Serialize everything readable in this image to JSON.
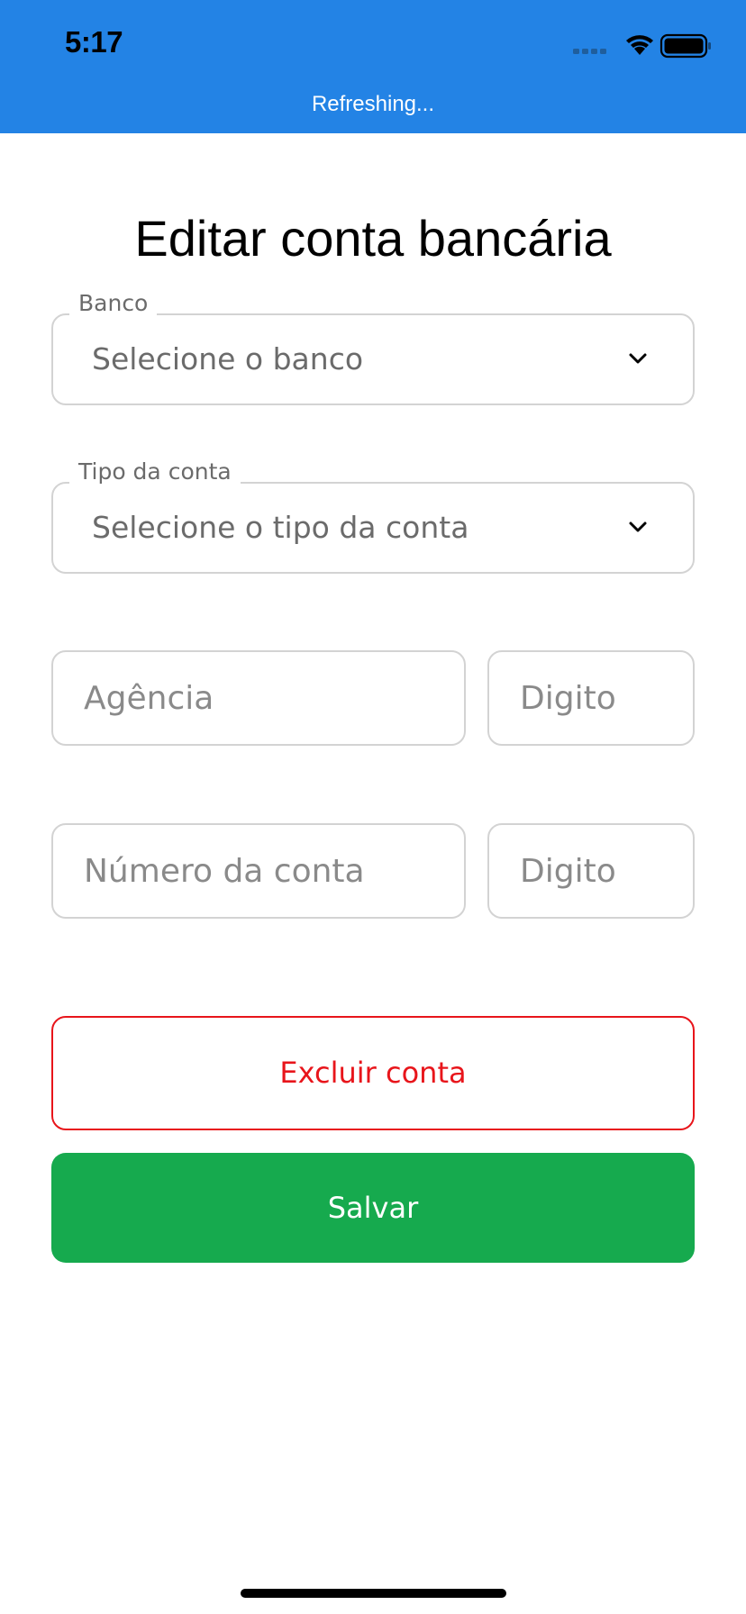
{
  "status_bar": {
    "time": "5:17",
    "refresh_text": "Refreshing...",
    "background_color": "#2383e5",
    "icons": [
      "signal-icon",
      "wifi-icon",
      "battery-icon"
    ]
  },
  "page": {
    "title": "Editar conta bancária"
  },
  "form": {
    "bank": {
      "label": "Banco",
      "value": "Selecione o banco",
      "icon": "chevron-down-icon"
    },
    "account_type": {
      "label": "Tipo da conta",
      "value": "Selecione o tipo da conta",
      "icon": "chevron-down-icon"
    },
    "agency": {
      "placeholder": "Agência",
      "value": ""
    },
    "agency_digit": {
      "placeholder": "Digito",
      "value": ""
    },
    "account_number": {
      "placeholder": "Número da conta",
      "value": ""
    },
    "account_digit": {
      "placeholder": "Digito",
      "value": ""
    }
  },
  "actions": {
    "delete_label": "Excluir conta",
    "delete_color": "#e8151b",
    "save_label": "Salvar",
    "save_color": "#16aa4e"
  }
}
